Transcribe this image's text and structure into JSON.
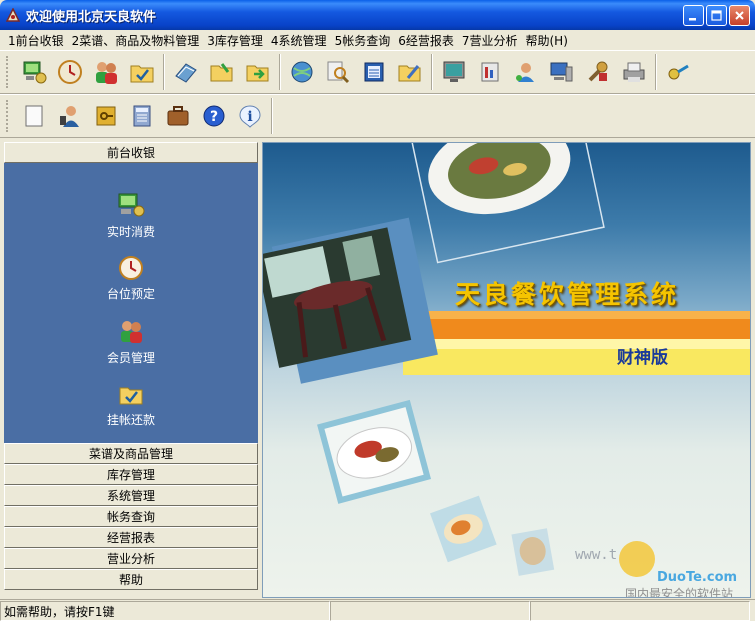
{
  "window": {
    "title": "欢迎使用北京天良软件",
    "controls": [
      "minimize-icon",
      "maximize-icon",
      "close-icon"
    ]
  },
  "menu": [
    {
      "id": "frontdesk",
      "label": "1前台收银"
    },
    {
      "id": "menu-materials",
      "label": "2菜谱、商品及物料管理"
    },
    {
      "id": "inventory",
      "label": "3库存管理"
    },
    {
      "id": "system",
      "label": "4系统管理"
    },
    {
      "id": "accounts",
      "label": "5帐务查询"
    },
    {
      "id": "reports",
      "label": "6经营报表"
    },
    {
      "id": "analysis",
      "label": "7营业分析"
    },
    {
      "id": "help",
      "label": "帮助(H)"
    }
  ],
  "left_panel": {
    "active_section": "前台收银",
    "items": [
      {
        "label": "实时消费",
        "icon": "computer-cash-icon"
      },
      {
        "label": "台位预定",
        "icon": "clock-icon"
      },
      {
        "label": "会员管理",
        "icon": "members-icon"
      },
      {
        "label": "挂帐还款",
        "icon": "folder-check-icon"
      }
    ],
    "sections": [
      "菜谱及商品管理",
      "库存管理",
      "系统管理",
      "帐务查询",
      "经营报表",
      "营业分析",
      "帮助"
    ]
  },
  "splash": {
    "title": "天良餐饮管理系统",
    "edition": "财神版",
    "watermark_url": "www.t",
    "watermark_brand": "DuoTe.com",
    "watermark_slogan": "国内最安全的软件站"
  },
  "status": {
    "text": "如需帮助，请按F1键"
  },
  "colors": {
    "title_blue": "#0842C8",
    "panel_blue": "#4A6EA4",
    "splash_title": "#F5C400",
    "stripe_orange": "#F08A1C"
  }
}
